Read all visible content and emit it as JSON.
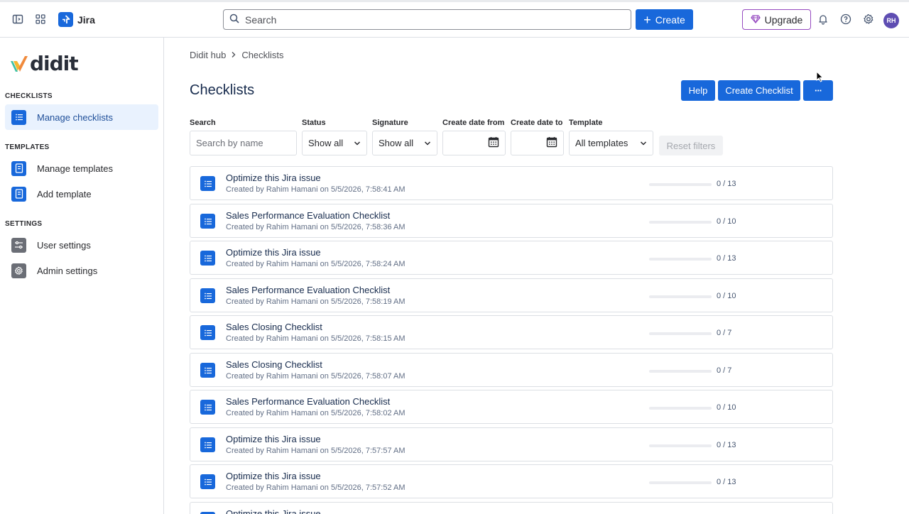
{
  "topbar": {
    "app_name": "Jira",
    "search_placeholder": "Search",
    "create_label": "Create",
    "upgrade_label": "Upgrade",
    "avatar_initials": "RH",
    "brand_color": "#1868db"
  },
  "sidebar": {
    "logo_text": "didit",
    "sections": {
      "checklists": "CHECKLISTS",
      "templates": "TEMPLATES",
      "settings": "SETTINGS"
    },
    "items": [
      {
        "label": "Manage checklists",
        "icon": "list-icon",
        "active": true
      },
      {
        "label": "Manage templates",
        "icon": "document-icon"
      },
      {
        "label": "Add template",
        "icon": "document-add-icon"
      },
      {
        "label": "User settings",
        "icon": "sliders-icon"
      },
      {
        "label": "Admin settings",
        "icon": "gear-icon"
      }
    ]
  },
  "main": {
    "breadcrumb": [
      "Didit hub",
      "Checklists"
    ],
    "title": "Checklists",
    "help_label": "Help",
    "create_checklist_label": "Create Checklist",
    "more_label": "···",
    "filters": {
      "search_label": "Search",
      "search_placeholder": "Search by name",
      "status_label": "Status",
      "status_value": "Show all",
      "signature_label": "Signature",
      "signature_value": "Show all",
      "date_from_label": "Create date from",
      "date_to_label": "Create date to",
      "template_label": "Template",
      "template_value": "All templates",
      "reset_label": "Reset filters"
    },
    "rows": [
      {
        "title": "Optimize this Jira issue",
        "sub": "Created by Rahim Hamani on 5/5/2026, 7:58:41 AM",
        "count": "0 / 13",
        "progress": 0
      },
      {
        "title": "Sales Performance Evaluation Checklist",
        "sub": "Created by Rahim Hamani on 5/5/2026, 7:58:36 AM",
        "count": "0 / 10",
        "progress": 0
      },
      {
        "title": "Optimize this Jira issue",
        "sub": "Created by Rahim Hamani on 5/5/2026, 7:58:24 AM",
        "count": "0 / 13",
        "progress": 0
      },
      {
        "title": "Sales Performance Evaluation Checklist",
        "sub": "Created by Rahim Hamani on 5/5/2026, 7:58:19 AM",
        "count": "0 / 10",
        "progress": 0
      },
      {
        "title": "Sales Closing Checklist",
        "sub": "Created by Rahim Hamani on 5/5/2026, 7:58:15 AM",
        "count": "0 / 7",
        "progress": 0
      },
      {
        "title": "Sales Closing Checklist",
        "sub": "Created by Rahim Hamani on 5/5/2026, 7:58:07 AM",
        "count": "0 / 7",
        "progress": 0
      },
      {
        "title": "Sales Performance Evaluation Checklist",
        "sub": "Created by Rahim Hamani on 5/5/2026, 7:58:02 AM",
        "count": "0 / 10",
        "progress": 0
      },
      {
        "title": "Optimize this Jira issue",
        "sub": "Created by Rahim Hamani on 5/5/2026, 7:57:57 AM",
        "count": "0 / 13",
        "progress": 0
      },
      {
        "title": "Optimize this Jira issue",
        "sub": "Created by Rahim Hamani on 5/5/2026, 7:57:52 AM",
        "count": "0 / 13",
        "progress": 0
      },
      {
        "title": "Optimize this Jira issue",
        "sub": "",
        "count": "",
        "progress": 0
      }
    ]
  }
}
